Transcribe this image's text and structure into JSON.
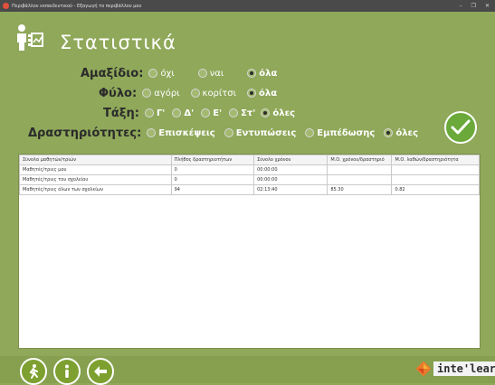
{
  "window": {
    "title": "Περιβάλλον εκπαιδευτικού - Εξαγωγή το περιβάλλον μου",
    "minimize": "–",
    "maximize": "❐",
    "close": "✕"
  },
  "page": {
    "title": "Στατιστικά"
  },
  "filters": {
    "amaxidio": {
      "label": "Αμαξίδιο:",
      "options": [
        "όχι",
        "ναι",
        "όλα"
      ],
      "selected": "όλα"
    },
    "fylo": {
      "label": "Φύλο:",
      "options": [
        "αγόρι",
        "κορίτσι",
        "όλα"
      ],
      "selected": "όλα"
    },
    "taxi": {
      "label": "Τάξη:",
      "options": [
        "Γ'",
        "Δ'",
        "Ε'",
        "Στ'",
        "όλες"
      ],
      "selected": "όλες"
    },
    "drastiriotites": {
      "label": "Δραστηριότητες:",
      "options": [
        "Επισκέψεις",
        "Εντυπώσεις",
        "Εμπέδωσης",
        "όλες"
      ],
      "selected": "όλες"
    }
  },
  "table": {
    "headers": [
      "Σύνολα μαθητών/τριών",
      "Πλήθος δραστηριοτήτων",
      "Σύνολο χρόνου",
      "Μ.Ο. χρόνου/δραστηριό",
      "Μ.Ο. λαθών/δραστηριότητα"
    ],
    "rows": [
      [
        "Μαθητές/τριες μου",
        "0",
        "00:00:00",
        "",
        ""
      ],
      [
        "Μαθητές/τριες του σχολείου",
        "0",
        "00:00:00",
        "",
        ""
      ],
      [
        "Μαθητές/τριες όλων των σχολείων",
        "94",
        "02:13:40",
        "85.30",
        "0.82"
      ]
    ]
  },
  "footer": {
    "brand": "inte'learn"
  },
  "colors": {
    "background": "#8fa85a",
    "accent": "#6aa93a",
    "title": "#ffffff"
  },
  "icons": [
    "app-icon",
    "student-icon",
    "ok-check-icon",
    "exit-icon",
    "info-icon",
    "back-arrow-icon",
    "brand-logo-icon"
  ]
}
